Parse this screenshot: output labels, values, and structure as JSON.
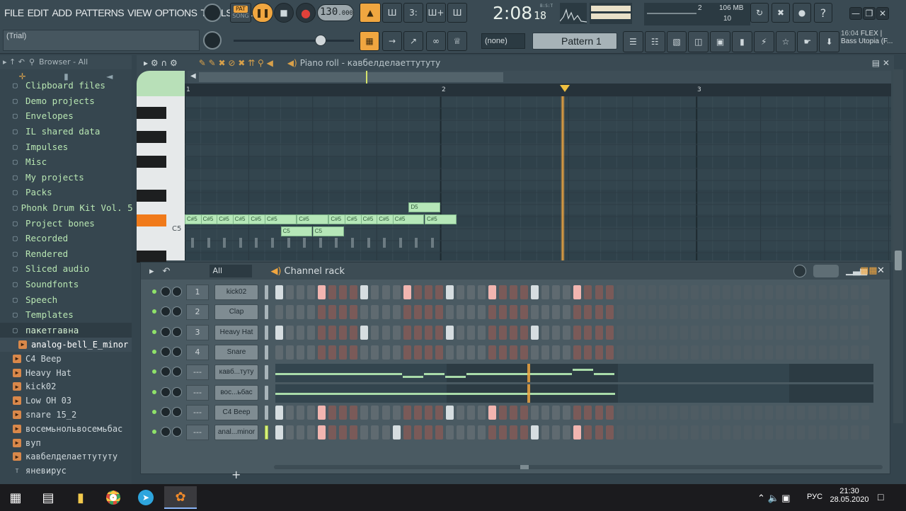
{
  "menu": [
    "FILE",
    "EDIT",
    "ADD",
    "PATTERNS",
    "VIEW",
    "OPTIONS",
    "TOOLS",
    "HELP"
  ],
  "hint": "(Trial)",
  "transport": {
    "pat_label": "PAT",
    "song_label": "SONG",
    "tempo": "130",
    "tempo_decimals": ".000",
    "time_main": "2:08",
    "time_small": "18",
    "time_unit": "B:S:T",
    "cpu_value": "2",
    "mem_value": "106 MB",
    "poly_value": "10",
    "pattern_name": "Pattern 1",
    "none_label": "(none)"
  },
  "news": {
    "time": "16:04",
    "text1": "FLEX |",
    "text2": "Bass Utopia (F..."
  },
  "browser": {
    "header": "Browser - All",
    "folders": [
      "Clipboard files",
      "Demo projects",
      "Envelopes",
      "IL shared data",
      "Impulses",
      "Misc",
      "My projects",
      "Packs",
      "Phonk Drum Kit Vol. 5",
      "Project bones",
      "Recorded",
      "Rendered",
      "Sliced audio",
      "Soundfonts",
      "Speech",
      "Templates",
      "пакетгавна"
    ],
    "files": [
      "analog-bell_E_minor",
      "C4 Beep",
      "Heavy Hat",
      "kick02",
      "Low OH 03",
      "snare 15_2",
      "восемьнольвосемьбас",
      "вуп",
      "кавбелделаеттутуту",
      "яневирус"
    ]
  },
  "piano_roll": {
    "title": "Piano roll - кавбелделаеттутуту",
    "bar_numbers": [
      "1",
      "2",
      "3"
    ],
    "key_label": "C5",
    "notes": [
      {
        "label": "C#5",
        "start": 0,
        "len": 0.5,
        "row": "C#5"
      },
      {
        "label": "C#5",
        "start": 0.5,
        "len": 0.5,
        "row": "C#5"
      },
      {
        "label": "C#5",
        "start": 1,
        "len": 0.5,
        "row": "C#5"
      },
      {
        "label": "C#5",
        "start": 1.5,
        "len": 0.5,
        "row": "C#5"
      },
      {
        "label": "C#5",
        "start": 2,
        "len": 0.5,
        "row": "C#5"
      },
      {
        "label": "C#5",
        "start": 2.5,
        "len": 0.5,
        "row": "C#5"
      },
      {
        "label": "C5",
        "start": 3,
        "len": 0.5,
        "row": "C5"
      },
      {
        "label": "C#5",
        "start": 3.5,
        "len": 0.5,
        "row": "C#5"
      },
      {
        "label": "C5",
        "start": 4,
        "len": 0.5,
        "row": "C5"
      },
      {
        "label": "C#5",
        "start": 4.5,
        "len": 0.5,
        "row": "C#5"
      },
      {
        "label": "C#5",
        "start": 5,
        "len": 0.5,
        "row": "C#5"
      },
      {
        "label": "C#5",
        "start": 5.5,
        "len": 0.5,
        "row": "C#5"
      },
      {
        "label": "C#5",
        "start": 6,
        "len": 0.5,
        "row": "C#5"
      },
      {
        "label": "C#5",
        "start": 6.5,
        "len": 0.5,
        "row": "C#5"
      },
      {
        "label": "D5",
        "start": 7,
        "len": 0.5,
        "row": "D5"
      },
      {
        "label": "C#5",
        "start": 7.5,
        "len": 0.5,
        "row": "C#5"
      }
    ],
    "playhead_step": 4.5
  },
  "channel_rack": {
    "title": "Channel rack",
    "filter": "All",
    "channels": [
      {
        "num": "1",
        "name": "kick02",
        "type": "steps",
        "pattern": [
          1,
          0,
          0,
          0,
          1,
          0,
          0,
          0,
          1,
          0,
          0,
          0,
          1,
          0,
          0,
          0,
          1,
          0,
          0,
          0,
          1,
          0,
          0,
          0,
          1,
          0,
          0,
          0,
          1,
          0,
          0,
          0
        ]
      },
      {
        "num": "2",
        "name": "Clap",
        "type": "steps",
        "pattern": [
          0,
          0,
          0,
          0,
          0,
          0,
          0,
          0,
          0,
          0,
          0,
          0,
          0,
          0,
          0,
          0,
          0,
          0,
          0,
          0,
          0,
          0,
          0,
          0,
          0,
          0,
          0,
          0,
          0,
          0,
          0,
          0
        ]
      },
      {
        "num": "3",
        "name": "Heavy Hat",
        "type": "steps",
        "pattern": [
          1,
          0,
          0,
          0,
          0,
          0,
          0,
          0,
          1,
          0,
          0,
          0,
          0,
          0,
          0,
          0,
          1,
          0,
          0,
          0,
          0,
          0,
          0,
          0,
          1,
          0,
          0,
          0,
          0,
          0,
          0,
          0
        ]
      },
      {
        "num": "4",
        "name": "Snare",
        "type": "steps",
        "pattern": [
          0,
          0,
          0,
          0,
          0,
          0,
          0,
          0,
          0,
          0,
          0,
          0,
          0,
          0,
          0,
          0,
          0,
          0,
          0,
          0,
          0,
          0,
          0,
          0,
          0,
          0,
          0,
          0,
          0,
          0,
          0,
          0
        ]
      },
      {
        "num": "---",
        "name": "кавб...туту",
        "type": "roll"
      },
      {
        "num": "---",
        "name": "вос...ьбас",
        "type": "roll"
      },
      {
        "num": "---",
        "name": "C4 Beep",
        "type": "steps",
        "pattern": [
          1,
          0,
          0,
          0,
          1,
          0,
          0,
          0,
          0,
          0,
          0,
          0,
          0,
          0,
          0,
          0,
          1,
          0,
          0,
          0,
          1,
          0,
          0,
          0,
          0,
          0,
          0,
          0,
          0,
          0,
          0,
          0
        ]
      },
      {
        "num": "---",
        "name": "anal...minor",
        "type": "steps",
        "pattern": [
          1,
          0,
          0,
          0,
          1,
          0,
          0,
          0,
          0,
          0,
          0,
          1,
          0,
          0,
          0,
          0,
          0,
          0,
          0,
          0,
          0,
          0,
          0,
          0,
          1,
          0,
          0,
          0,
          1,
          0,
          0,
          0
        ]
      }
    ]
  },
  "taskbar": {
    "lang": "РУС",
    "time": "21:30",
    "date": "28.05.2020"
  },
  "colors": {
    "accent": "#f0a640",
    "note": "#b6e7b8",
    "bg": "#3a4a53"
  }
}
